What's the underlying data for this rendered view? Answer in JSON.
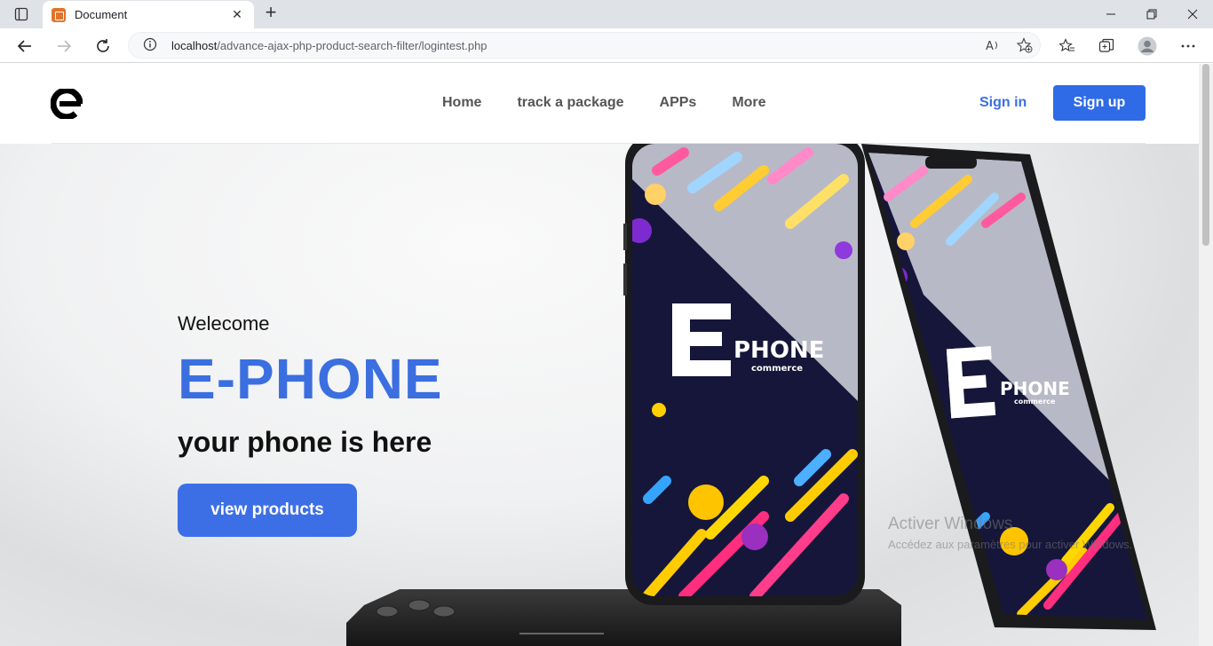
{
  "browser": {
    "tab_title": "Document",
    "url_host": "localhost",
    "url_path": "/advance-ajax-php-product-search-filter/logintest.php"
  },
  "header": {
    "nav": [
      "Home",
      "track a package",
      "APPs",
      "More"
    ],
    "signin": "Sign in",
    "signup": "Sign up"
  },
  "hero": {
    "welcome": "Welecome",
    "brand": "E-PHONE",
    "tagline": "your phone is here",
    "cta": "view products",
    "screen_logo_main": "PHONE",
    "screen_logo_sub": "commerce"
  },
  "watermark": {
    "line1": "Activer Windows",
    "line2": "Accédez aux paramètres pour activer Windows."
  },
  "colors": {
    "accent": "#3b6fe0",
    "button": "#2f6be7"
  }
}
